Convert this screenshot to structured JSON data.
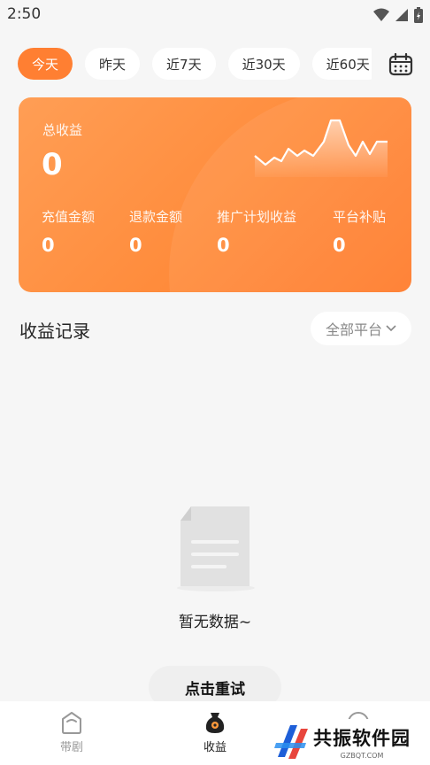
{
  "status_bar": {
    "time": "2:50"
  },
  "filters": [
    {
      "label": "今天",
      "active": true
    },
    {
      "label": "昨天",
      "active": false
    },
    {
      "label": "近7天",
      "active": false
    },
    {
      "label": "近30天",
      "active": false
    },
    {
      "label": "近60天",
      "active": false
    }
  ],
  "summary": {
    "title": "总收益",
    "total": "0",
    "metrics": [
      {
        "label": "充值金额",
        "value": "0"
      },
      {
        "label": "退款金额",
        "value": "0"
      },
      {
        "label": "推广计划收益",
        "value": "0"
      },
      {
        "label": "平台补贴",
        "value": "0"
      }
    ]
  },
  "records": {
    "title": "收益记录",
    "platform_filter": "全部平台"
  },
  "empty_state": {
    "message": "暂无数据~",
    "retry_label": "点击重试"
  },
  "tab_bar": {
    "items": [
      {
        "label": "带剧",
        "icon": "home-icon",
        "active": false
      },
      {
        "label": "收益",
        "icon": "money-bag-icon",
        "active": true
      },
      {
        "label": "",
        "icon": "more-icon",
        "active": false
      }
    ]
  },
  "watermark": {
    "name": "共振软件园",
    "site": "GZBQT.COM"
  },
  "colors": {
    "accent": "#ff7f32",
    "card_start": "#ff9e55",
    "card_end": "#ff7a2a",
    "background": "#f6f6f6"
  }
}
